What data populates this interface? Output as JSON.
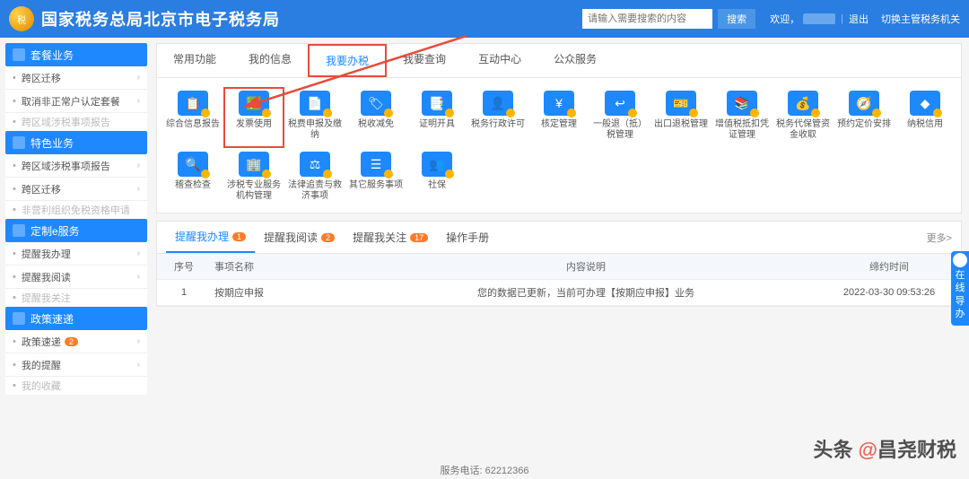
{
  "header": {
    "title": "国家税务总局北京市电子税务局",
    "search_placeholder": "请输入需要搜索的内容",
    "search_btn": "搜索",
    "welcome": "欢迎，",
    "logout": "退出",
    "switch": "切换主管税务机关"
  },
  "sidebar": {
    "g1": {
      "title": "套餐业务",
      "items": [
        "跨区迁移",
        "取消非正常户认定套餐",
        "跨区域涉税事项报告"
      ]
    },
    "g2": {
      "title": "特色业务",
      "items": [
        "跨区域涉税事项报告",
        "跨区迁移",
        "非营利组织免税资格申请"
      ]
    },
    "g3": {
      "title": "定制e服务",
      "items": [
        "提醒我办理",
        "提醒我阅读",
        "提醒我关注"
      ]
    },
    "g4": {
      "title": "政策速递",
      "items": [
        {
          "label": "政策速递",
          "badge": "2"
        },
        {
          "label": "我的提醒"
        },
        {
          "label": "我的收藏"
        }
      ]
    }
  },
  "top_tabs": [
    "常用功能",
    "我的信息",
    "我要办税",
    "我要查询",
    "互动中心",
    "公众服务"
  ],
  "active_top_tab": 2,
  "services_row1": [
    {
      "label": "综合信息报告",
      "icon": "📋"
    },
    {
      "label": "发票使用",
      "icon": "✅",
      "highlight": true
    },
    {
      "label": "税费申报及缴纳",
      "icon": "📄"
    },
    {
      "label": "税收减免",
      "icon": "🏷"
    },
    {
      "label": "证明开具",
      "icon": "📑"
    },
    {
      "label": "税务行政许可",
      "icon": "👤"
    },
    {
      "label": "核定管理",
      "icon": "¥"
    },
    {
      "label": "一般退（抵）税管理",
      "icon": "↩"
    },
    {
      "label": "出口退税管理",
      "icon": "🎫"
    },
    {
      "label": "增值税抵扣凭证管理",
      "icon": "📚"
    },
    {
      "label": "税务代保管资金收取",
      "icon": "💰"
    },
    {
      "label": "预约定价安排",
      "icon": "🧭"
    },
    {
      "label": "纳税信用",
      "icon": "◆"
    }
  ],
  "services_row2": [
    {
      "label": "稽查检查",
      "icon": "🔍"
    },
    {
      "label": "涉税专业服务机构管理",
      "icon": "🏢"
    },
    {
      "label": "法律追责与救济事项",
      "icon": "⚖"
    },
    {
      "label": "其它服务事项",
      "icon": "☰"
    },
    {
      "label": "社保",
      "icon": "👥"
    }
  ],
  "alert_tabs": [
    {
      "label": "提醒我办理",
      "badge": "1",
      "active": true
    },
    {
      "label": "提醒我阅读",
      "badge": "2"
    },
    {
      "label": "提醒我关注",
      "badge": "17"
    },
    {
      "label": "操作手册"
    }
  ],
  "alert_more": "更多>",
  "table": {
    "cols": [
      "序号",
      "事项名称",
      "内容说明",
      "缔约时间"
    ],
    "rows": [
      {
        "seq": "1",
        "name": "按期应申报",
        "desc": "您的数据已更新，当前可办理【按期应申报】业务",
        "time": "2022-03-30 09:53:26"
      }
    ]
  },
  "footer": "服务电话: 62212366",
  "float_help": "在线导办",
  "watermark": {
    "prefix": "头条 ",
    "at": "@",
    "name": "昌尧财税"
  }
}
